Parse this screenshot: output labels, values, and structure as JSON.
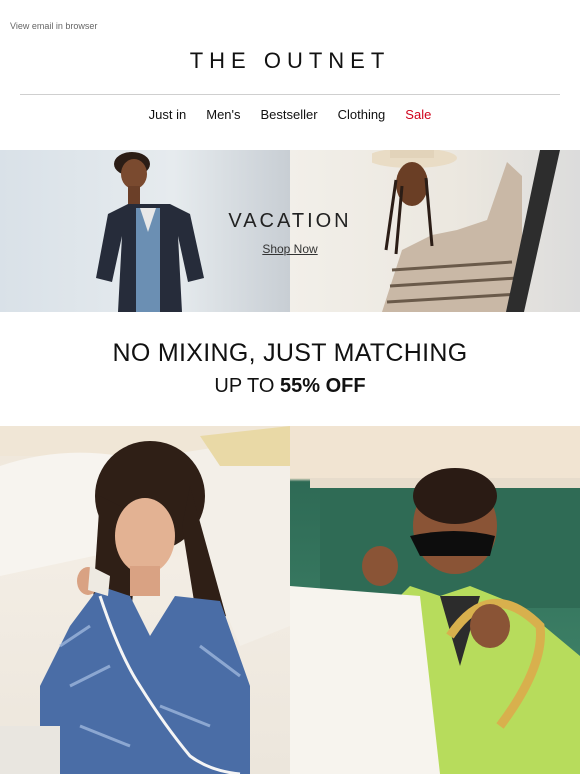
{
  "header": {
    "view_in_browser": "View email in browser",
    "logo": "THE OUTNET"
  },
  "nav": {
    "items": [
      {
        "label": "Just in"
      },
      {
        "label": "Men's"
      },
      {
        "label": "Bestseller"
      },
      {
        "label": "Clothing"
      },
      {
        "label": "Sale"
      }
    ]
  },
  "hero": {
    "title": "VACATION",
    "cta": "Shop Now"
  },
  "promo": {
    "headline": "NO MIXING, JUST MATCHING",
    "subline_prefix": "UP TO ",
    "subline_value": "55% OFF"
  },
  "colors": {
    "sale": "#d0021b"
  }
}
